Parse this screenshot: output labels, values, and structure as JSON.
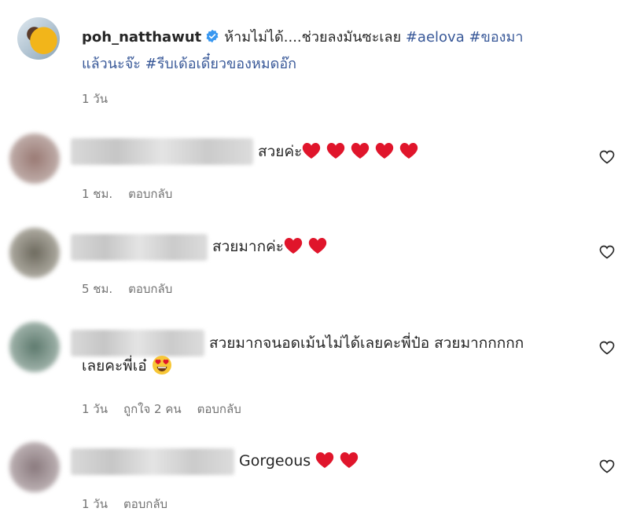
{
  "post": {
    "username": "poh_natthawut",
    "text": "ห้ามไม่ได้....ช่วยลงมันซะเลย",
    "tags": [
      "#aelova",
      "#ของมา",
      "แล้วนะจ๊ะ",
      "#รีบเด้อเดี๋ยวของหมดอ๊ก"
    ],
    "time": "1 วัน"
  },
  "comments": [
    {
      "text": "สวยค่ะ",
      "hearts": 5,
      "time": "1 ชม.",
      "reply": "ตอบกลับ"
    },
    {
      "text": "สวยมากค่ะ",
      "hearts": 2,
      "time": "5 ชม.",
      "reply": "ตอบกลับ"
    },
    {
      "text_line1": "สวยมากจนอดเม้นไม่ได้เลยคะพี่ป๋อ สวยมากกกกก",
      "text_line2": "เลยคะพี่เอ๋",
      "time": "1 วัน",
      "likes": "ถูกใจ 2 คน",
      "reply": "ตอบกลับ"
    },
    {
      "text": "Gorgeous",
      "hearts": 2,
      "time": "1 วัน",
      "reply": "ตอบกลับ"
    }
  ],
  "icons": {
    "like": "heart-outline-icon",
    "verified": "verified-badge-icon",
    "emoji_heart": "red-heart-emoji",
    "emoji_eyes": "heart-eyes-emoji"
  },
  "colors": {
    "hashtag": "#385898",
    "meta": "#737373",
    "heart": "#e0152b"
  }
}
